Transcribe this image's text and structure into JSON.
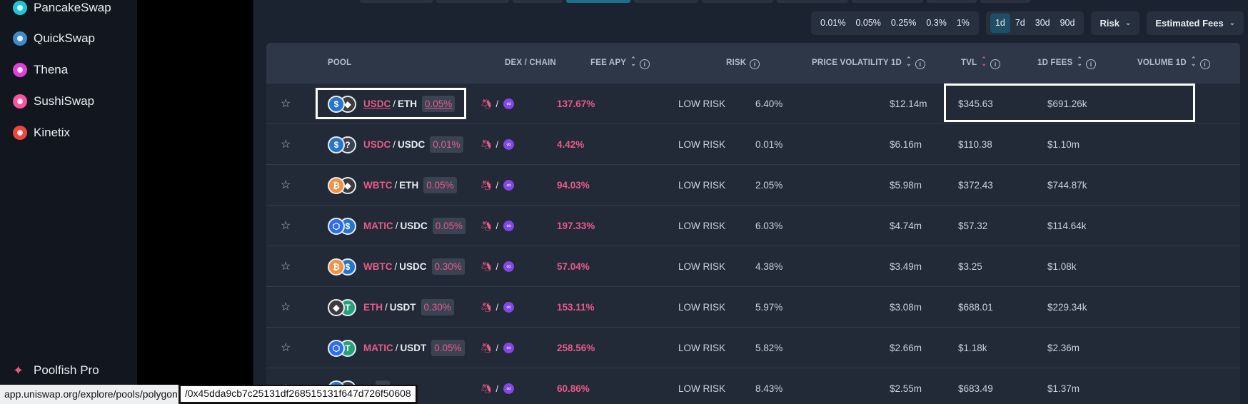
{
  "sidebar": {
    "items": [
      {
        "label": "PancakeSwap",
        "color": "#1fc7d4"
      },
      {
        "label": "QuickSwap",
        "color": "#418aca"
      },
      {
        "label": "Thena",
        "color": "#e03fd8"
      },
      {
        "label": "SushiSwap",
        "color": "#fa52a0"
      },
      {
        "label": "Kinetix",
        "color": "#f0443c"
      }
    ],
    "pro_label": "Poolfish Pro"
  },
  "controls": {
    "fee_tiers": [
      "0.01%",
      "0.05%",
      "0.25%",
      "0.3%",
      "1%"
    ],
    "timeframes": [
      "1d",
      "7d",
      "30d",
      "90d"
    ],
    "active_timeframe": "1d",
    "risk_dropdown": "Risk",
    "fees_dropdown": "Estimated Fees"
  },
  "table": {
    "headers": {
      "pool": "POOL",
      "dex_chain": "DEX / CHAIN",
      "fee_apy": "FEE APY",
      "risk": "RISK",
      "volatility": "PRICE VOLATILITY 1D",
      "tvl": "TVL",
      "fees": "1D FEES",
      "volume": "VOLUME 1D"
    },
    "rows": [
      {
        "base": "USDC",
        "quote": "ETH",
        "fee": "0.05%",
        "apy": "137.67%",
        "risk": "LOW RISK",
        "volatility": "6.40%",
        "tvl": "$12.14m",
        "fees": "$345.63",
        "volume": "$691.26k",
        "icon_a": "usdc-icon",
        "icon_b": "eth-icon"
      },
      {
        "base": "USDC",
        "quote": "USDC",
        "fee": "0.01%",
        "apy": "4.42%",
        "risk": "LOW RISK",
        "volatility": "0.01%",
        "tvl": "$6.16m",
        "fees": "$110.38",
        "volume": "$1.10m",
        "icon_a": "usdc-icon",
        "icon_b": "unknown-token-icon"
      },
      {
        "base": "WBTC",
        "quote": "ETH",
        "fee": "0.05%",
        "apy": "94.03%",
        "risk": "LOW RISK",
        "volatility": "2.05%",
        "tvl": "$5.98m",
        "fees": "$372.43",
        "volume": "$744.87k",
        "icon_a": "wbtc-icon",
        "icon_b": "eth-icon"
      },
      {
        "base": "MATIC",
        "quote": "USDC",
        "fee": "0.05%",
        "apy": "197.33%",
        "risk": "LOW RISK",
        "volatility": "6.03%",
        "tvl": "$4.74m",
        "fees": "$57.32",
        "volume": "$114.64k",
        "icon_a": "matic-icon",
        "icon_b": "usdc-icon"
      },
      {
        "base": "WBTC",
        "quote": "USDC",
        "fee": "0.30%",
        "apy": "57.04%",
        "risk": "LOW RISK",
        "volatility": "4.38%",
        "tvl": "$3.49m",
        "fees": "$3.25",
        "volume": "$1.08k",
        "icon_a": "wbtc-icon",
        "icon_b": "usdc-icon"
      },
      {
        "base": "ETH",
        "quote": "USDT",
        "fee": "0.30%",
        "apy": "153.11%",
        "risk": "LOW RISK",
        "volatility": "5.97%",
        "tvl": "$3.08m",
        "fees": "$688.01",
        "volume": "$229.34k",
        "icon_a": "eth-icon",
        "icon_b": "usdt-icon"
      },
      {
        "base": "MATIC",
        "quote": "USDT",
        "fee": "0.05%",
        "apy": "258.56%",
        "risk": "LOW RISK",
        "volatility": "5.82%",
        "tvl": "$2.66m",
        "fees": "$1.18k",
        "volume": "$2.36m",
        "icon_a": "matic-icon",
        "icon_b": "usdt-icon"
      },
      {
        "base": "",
        "quote": "",
        "fee": "%",
        "apy": "60.86%",
        "risk": "LOW RISK",
        "volatility": "8.43%",
        "tvl": "$2.55m",
        "fees": "$683.49",
        "volume": "$1.37m",
        "icon_a": "usdc-icon",
        "icon_b": "eth-icon"
      }
    ]
  },
  "status_bar": {
    "url_prefix": "app.uniswap.org/explore/pools/polygon",
    "url_highlight": "/0x45dda9cb7c25131df268515131f647d726f50608"
  },
  "colors": {
    "accent_pink": "#e85a8a",
    "polygon_purple": "#8247e5",
    "active_tab": "#1f6f8b"
  }
}
